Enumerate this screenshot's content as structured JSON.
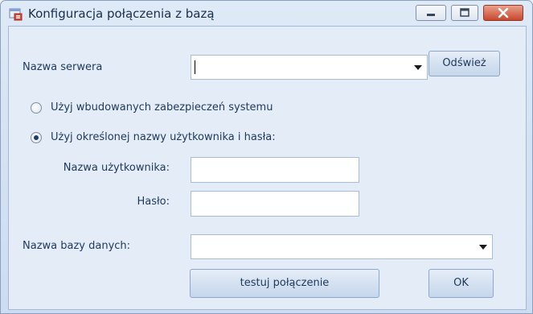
{
  "window": {
    "title": "Konfiguracja połączenia z bazą",
    "icon": "database-config-icon",
    "controls": [
      "minimize-icon",
      "maximize-icon",
      "close-icon"
    ]
  },
  "server": {
    "label": "Nazwa serwera",
    "value": "",
    "refresh_label": "Odśwież"
  },
  "auth": {
    "integrated_label": "Użyj wbudowanych zabezpieczeń systemu",
    "integrated_selected": false,
    "sql_label": "Użyj określonej nazwy użytkownika i hasła:",
    "sql_selected": true,
    "username_label": "Nazwa użytkownika:",
    "username_value": "",
    "password_label": "Hasło:",
    "password_value": ""
  },
  "database": {
    "label": "Nazwa bazy danych:",
    "value": ""
  },
  "actions": {
    "test_label": "testuj połączenie",
    "ok_label": "OK"
  },
  "colors": {
    "window_frame": "#8aa0be",
    "content_bg": "#e3ecf7",
    "close_button": "#c9472c"
  }
}
